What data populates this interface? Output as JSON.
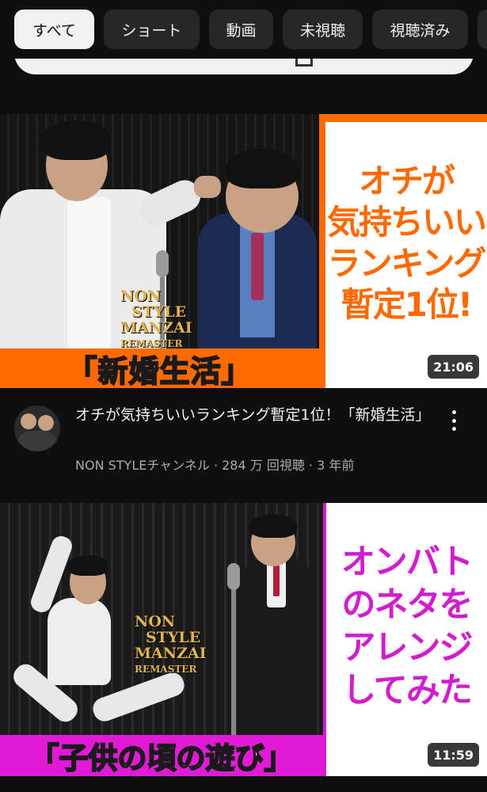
{
  "chips": [
    {
      "label": "すべて",
      "active": true
    },
    {
      "label": "ショート",
      "active": false
    },
    {
      "label": "動画",
      "active": false
    },
    {
      "label": "未視聴",
      "active": false
    },
    {
      "label": "視聴済み",
      "active": false
    }
  ],
  "videos": [
    {
      "thumbnail": {
        "caption": "「新婚生活」",
        "panel_lines": [
          "オチが",
          "気持ちいい",
          "ランキング",
          "暫定1位!"
        ],
        "brand_lines": [
          "NON",
          "STYLE",
          "MANZAI",
          "REMASTER"
        ],
        "duration": "21:06"
      },
      "title": "オチが気持ちいいランキング暫定1位！「新婚生活」",
      "subline": "NON STYLEチャンネル · 284 万 回視聴 · 3 年前"
    },
    {
      "thumbnail": {
        "caption": "「子供の頃の遊び」",
        "panel_lines": [
          "オンバト",
          "のネタを",
          "アレンジ",
          "してみた"
        ],
        "brand_lines": [
          "NON",
          "STYLE",
          "MANZAI",
          "REMASTER"
        ],
        "duration": "11:59"
      }
    }
  ],
  "colors": {
    "background": "#0f0f0f",
    "chip": "#272727",
    "chip_active": "#f1f1f1",
    "accent_orange": "#ff6a00",
    "accent_magenta": "#d11ccf"
  }
}
